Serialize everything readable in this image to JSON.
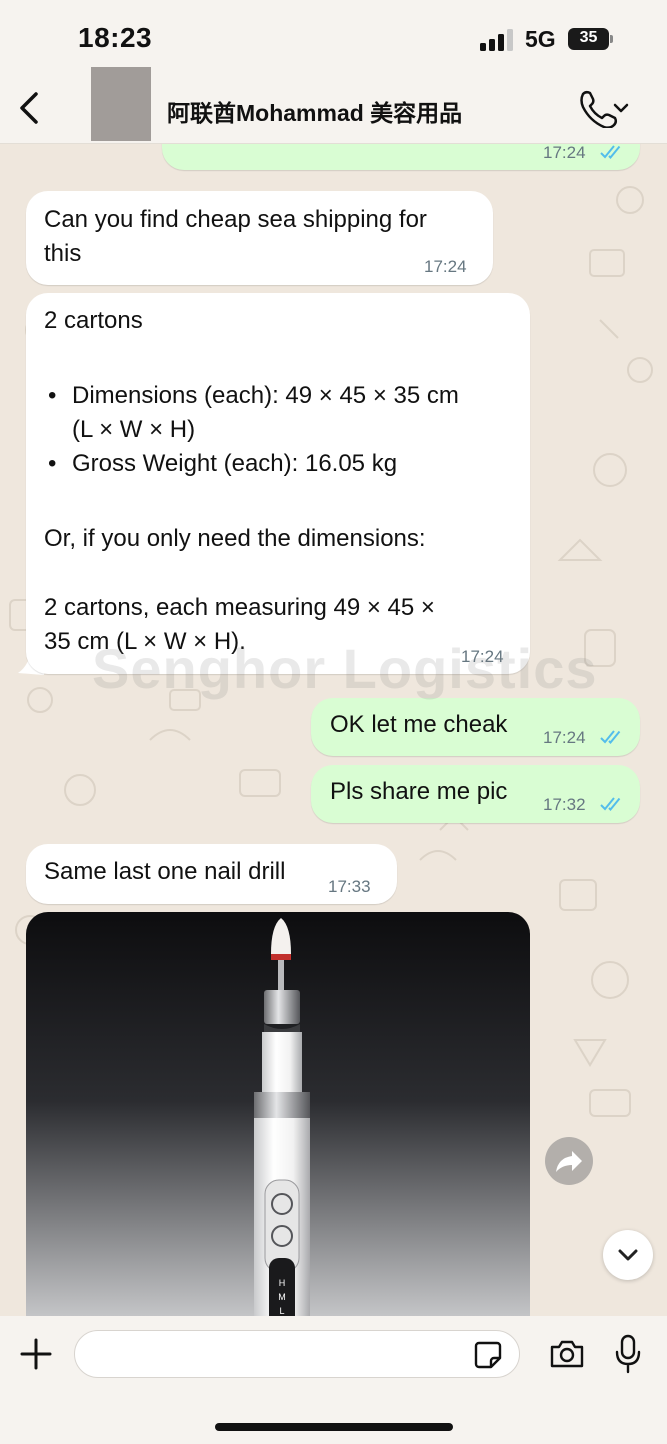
{
  "status_bar": {
    "time": "18:23",
    "network": "5G",
    "battery": "35"
  },
  "header": {
    "title": "阿联酋Mohammad 美容用品"
  },
  "messages": [
    {
      "direction": "outgoing",
      "time": "17:24",
      "status": "read"
    },
    {
      "direction": "incoming",
      "lines": [
        "Can you find cheap sea shipping for",
        "this"
      ],
      "time": "17:24"
    },
    {
      "direction": "incoming",
      "intro": "2 cartons",
      "bullets": [
        [
          "Dimensions (each): 49 × 45 × 35 cm",
          "(L × W × H)"
        ],
        [
          "Gross Weight (each): 16.05 kg"
        ]
      ],
      "middle": "Or, if you only need the dimensions:",
      "closing": [
        "2 cartons, each measuring 49 × 45 ×",
        "35 cm (L × W × H)."
      ],
      "time": "17:24"
    },
    {
      "direction": "outgoing",
      "text": "OK let me cheak",
      "time": "17:24",
      "status": "read"
    },
    {
      "direction": "outgoing",
      "text": "Pls share me pic",
      "time": "17:32",
      "status": "read"
    },
    {
      "direction": "incoming",
      "text": "Same last one nail drill",
      "time": "17:33"
    },
    {
      "direction": "incoming",
      "type": "image",
      "image_labels": [
        "H",
        "M",
        "L"
      ]
    }
  ],
  "watermark": "Senghor Logistics",
  "input": {
    "placeholder": ""
  },
  "icons": {
    "back": "chevron-left-icon",
    "call": "phone-icon",
    "add": "plus-icon",
    "sticker": "sticker-icon",
    "camera": "camera-icon",
    "mic": "microphone-icon",
    "forward": "forward-icon",
    "scroll": "chevron-down-icon"
  },
  "colors": {
    "outgoing_bubble": "#d9fdd3",
    "incoming_bubble": "#ffffff",
    "read_ticks": "#53bdeb",
    "chat_background": "#efe7dd"
  }
}
